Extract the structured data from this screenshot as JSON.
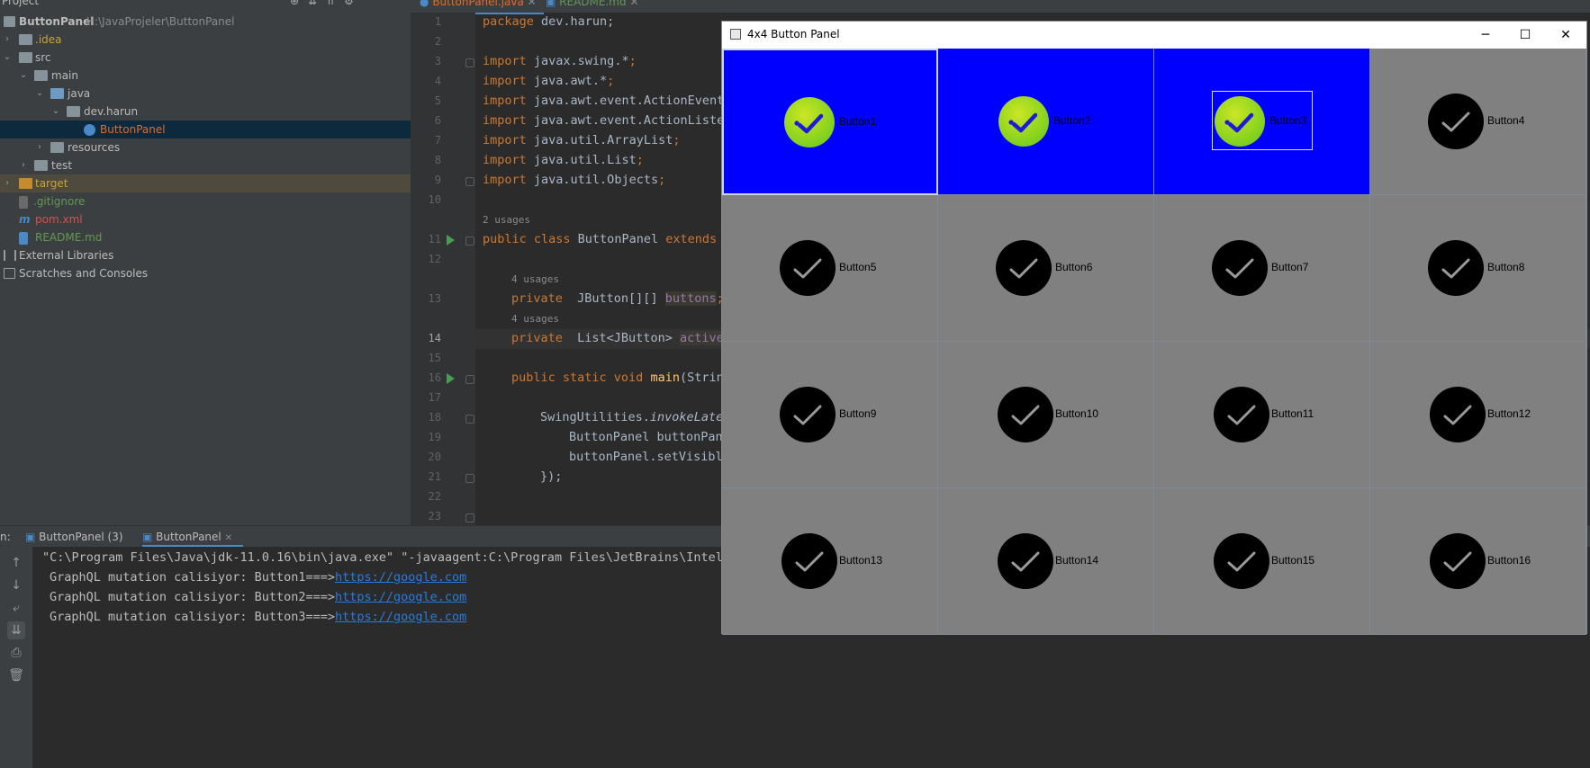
{
  "project": {
    "header_title": "Project",
    "root_name": "ButtonPanel",
    "root_path": "H:\\JavaProjeler\\ButtonPanel",
    "items": [
      {
        "label": "ButtonPanel",
        "color": "#bbbbbb"
      },
      {
        "label": ".idea",
        "color": "#c8a335"
      },
      {
        "label": "src",
        "color": "#bbbbbb"
      },
      {
        "label": "main",
        "color": "#bbbbbb"
      },
      {
        "label": "java",
        "color": "#bbbbbb"
      },
      {
        "label": "dev.harun",
        "color": "#bbbbbb"
      },
      {
        "label": "ButtonPanel",
        "color": "#e06c2a"
      },
      {
        "label": "resources",
        "color": "#bbbbbb"
      },
      {
        "label": "test",
        "color": "#bbbbbb"
      },
      {
        "label": "target",
        "color": "#c8a335"
      },
      {
        "label": ".gitignore",
        "color": "#629755"
      },
      {
        "label": "pom.xml",
        "color": "#d25252"
      },
      {
        "label": "README.md",
        "color": "#629755"
      },
      {
        "label": "External Libraries",
        "color": "#bbbbbb"
      },
      {
        "label": "Scratches and Consoles",
        "color": "#bbbbbb"
      }
    ]
  },
  "editor": {
    "tabs": [
      "ButtonPanel.java",
      "README.md"
    ],
    "line_numbers": [
      "1",
      "2",
      "3",
      "4",
      "5",
      "6",
      "7",
      "8",
      "9",
      "10",
      "11",
      "12",
      "13",
      "14",
      "15",
      "16",
      "17",
      "18",
      "19",
      "20",
      "21",
      "22",
      "23"
    ],
    "usages": [
      "2 usages",
      "4 usages",
      "4 usages"
    ],
    "code": {
      "l1_kw": "package",
      "l1_rest": " dev.harun;",
      "l3_kw": "import",
      "l3_rest": " javax.swing.*",
      "l4_kw": "import",
      "l4_rest": " java.awt.*",
      "l5_kw": "import",
      "l5_rest": " java.awt.event.ActionEvent",
      "l6_kw": "import",
      "l6_rest": " java.awt.event.ActionListe",
      "l7_kw": "import",
      "l7_rest": " java.util.ArrayList",
      "l8_kw": "import",
      "l8_rest": " java.util.List",
      "l9_kw": "import",
      "l9_rest": " java.util.Objects",
      "semi": ";",
      "l11_kw": "public class",
      "l11_rest": " ButtonPanel ",
      "l11_kw2": "extends",
      "l13_kw": "private",
      "l13_rest": "  JButton[][] ",
      "l13_fld": "buttons",
      "l14_kw": "private",
      "l14_rest": "  List<JButton> ",
      "l14_fld": "active",
      "l16_kw": "public static void",
      "l16_mth": "main",
      "l16_rest": "(Strin",
      "l18_a": "SwingUtilities.",
      "l18_b": "invokeLate",
      "l19": "ButtonPanel buttonPan",
      "l20": "buttonPanel.setVisibl",
      "l21": "});"
    }
  },
  "console": {
    "tab_prefix": "n:",
    "tabs": [
      "ButtonPanel (3)",
      "ButtonPanel"
    ],
    "command": "\"C:\\Program Files\\Java\\jdk-11.0.16\\bin\\java.exe\" \"-javaagent:C:\\Program Files\\JetBrains\\Intell",
    "lines": [
      {
        "text": "GraphQL mutation calisiyor: Button1===>",
        "link": "https://google.com"
      },
      {
        "text": "GraphQL mutation calisiyor: Button2===>",
        "link": "https://google.com"
      },
      {
        "text": "GraphQL mutation calisiyor: Button3===>",
        "link": "https://google.com"
      }
    ]
  },
  "swing_window": {
    "title": "4x4 Button Panel",
    "controls": {
      "minimize": "─",
      "maximize": "☐",
      "close": "✕"
    },
    "active_color": "#0000ff",
    "inactive_color": "#808080",
    "buttons": [
      {
        "label": "Button1",
        "active": true
      },
      {
        "label": "Button2",
        "active": true
      },
      {
        "label": "Button3",
        "active": true
      },
      {
        "label": "Button4",
        "active": false
      },
      {
        "label": "Button5",
        "active": false
      },
      {
        "label": "Button6",
        "active": false
      },
      {
        "label": "Button7",
        "active": false
      },
      {
        "label": "Button8",
        "active": false
      },
      {
        "label": "Button9",
        "active": false
      },
      {
        "label": "Button10",
        "active": false
      },
      {
        "label": "Button11",
        "active": false
      },
      {
        "label": "Button12",
        "active": false
      },
      {
        "label": "Button13",
        "active": false
      },
      {
        "label": "Button14",
        "active": false
      },
      {
        "label": "Button15",
        "active": false
      },
      {
        "label": "Button16",
        "active": false
      }
    ]
  }
}
